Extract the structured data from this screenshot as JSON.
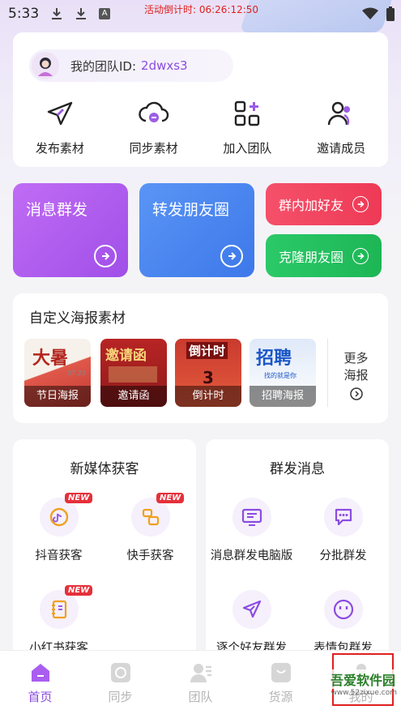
{
  "statusbar": {
    "time": "5:33",
    "countdown": "活动倒计时: 06:26:12:50",
    "notif_icon": "A"
  },
  "team": {
    "id_label": "我的团队ID:",
    "id_value": "2dwxs3",
    "actions": [
      {
        "label": "发布素材",
        "icon": "send-icon"
      },
      {
        "label": "同步素材",
        "icon": "cloud-sync-icon"
      },
      {
        "label": "加入团队",
        "icon": "grid-add-icon"
      },
      {
        "label": "邀请成员",
        "icon": "users-icon"
      }
    ]
  },
  "tiles": {
    "mass_message": {
      "label": "消息群发",
      "color": "#b05bf0"
    },
    "moments": {
      "label": "转发朋友圈",
      "color": "#4a86f0"
    },
    "add_friends": {
      "label": "群内加好友",
      "color": "#f0415e"
    },
    "clone_moments": {
      "label": "克隆朋友圈",
      "color": "#22c15e"
    }
  },
  "posters": {
    "title": "自定义海报素材",
    "items": [
      {
        "label": "节日海报",
        "headline": "大暑",
        "sub": "07.23"
      },
      {
        "label": "邀请函",
        "headline": "邀请函",
        "sub": ""
      },
      {
        "label": "倒计时",
        "headline": "倒计时",
        "sub": "3"
      },
      {
        "label": "招聘海报",
        "headline": "招聘",
        "sub": "找的就是你"
      }
    ],
    "more_label": "更多海报"
  },
  "new_media": {
    "title": "新媒体获客",
    "badge": "NEW",
    "items": [
      {
        "label": "抖音获客",
        "icon": "douyin-icon"
      },
      {
        "label": "快手获客",
        "icon": "kuaishou-icon"
      },
      {
        "label": "小红书获客",
        "icon": "notebook-icon"
      }
    ]
  },
  "group_msg": {
    "title": "群发消息",
    "items": [
      {
        "label": "消息群发电脑版",
        "icon": "desktop-message-icon"
      },
      {
        "label": "分批群发",
        "icon": "chat-bubble-icon"
      },
      {
        "label": "逐个好友群发",
        "icon": "send-icon"
      },
      {
        "label": "表情包群发",
        "icon": "emoji-icon"
      }
    ]
  },
  "tabs": [
    {
      "label": "首页",
      "active": true
    },
    {
      "label": "同步",
      "active": false
    },
    {
      "label": "团队",
      "active": false
    },
    {
      "label": "货源",
      "active": false
    },
    {
      "label": "我的",
      "active": false
    }
  ],
  "watermark": {
    "text": "吾爱软件园",
    "url": "www.52zixue.com"
  }
}
